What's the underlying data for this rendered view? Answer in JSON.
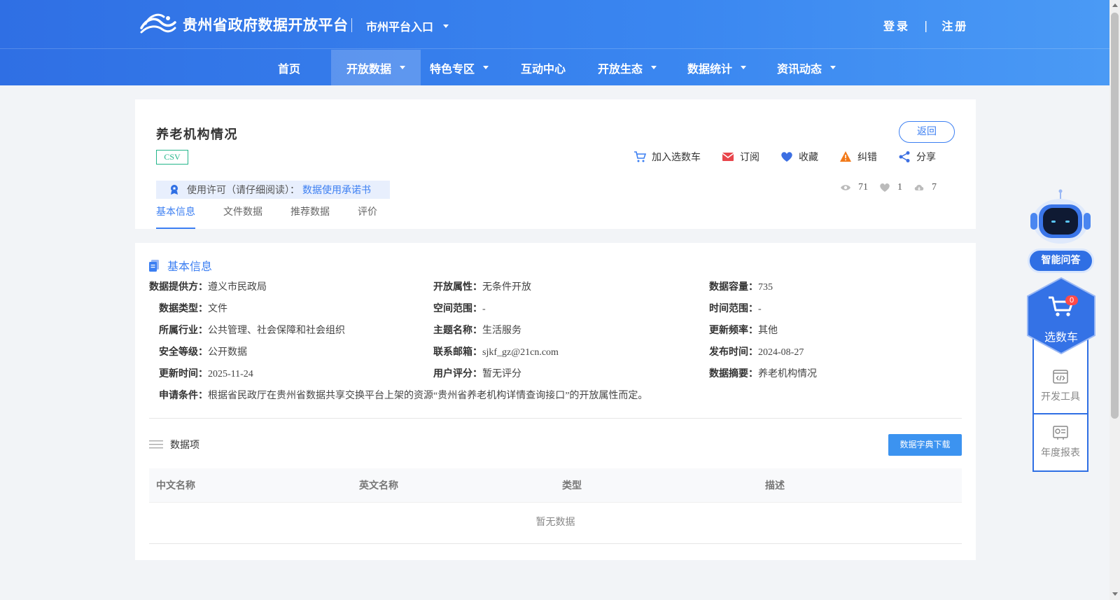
{
  "header": {
    "site_title": "贵州省政府数据开放平台",
    "city_entry": "市州平台入口",
    "login": "登录",
    "register": "注册",
    "auth_separator": "|",
    "nav": [
      {
        "label": "首页",
        "dropdown": false,
        "active": false
      },
      {
        "label": "开放数据",
        "dropdown": true,
        "active": true
      },
      {
        "label": "特色专区",
        "dropdown": true,
        "active": false
      },
      {
        "label": "互动中心",
        "dropdown": false,
        "active": false
      },
      {
        "label": "开放生态",
        "dropdown": true,
        "active": false
      },
      {
        "label": "数据统计",
        "dropdown": true,
        "active": false
      },
      {
        "label": "资讯动态",
        "dropdown": true,
        "active": false
      }
    ]
  },
  "dataset": {
    "title": "养老机构情况",
    "format_tag": "CSV",
    "back_label": "返回",
    "actions": [
      {
        "label": "加入选数车",
        "icon": "cart-icon"
      },
      {
        "label": "订阅",
        "icon": "mail-icon"
      },
      {
        "label": "收藏",
        "icon": "heart-icon"
      },
      {
        "label": "纠错",
        "icon": "warning-icon"
      },
      {
        "label": "分享",
        "icon": "share-icon"
      }
    ],
    "license_text": "使用许可（请仔细阅读）：",
    "license_link": "数据使用承诺书",
    "stats": {
      "views": "71",
      "likes": "1",
      "downloads": "7"
    },
    "tabs": [
      "基本信息",
      "文件数据",
      "推荐数据",
      "评价"
    ],
    "active_tab": 0
  },
  "basic_info": {
    "section_title": "基本信息",
    "rows": [
      [
        {
          "label": "数据提供方：",
          "value": "遵义市民政局"
        },
        {
          "label": "开放属性：",
          "value": "无条件开放"
        },
        {
          "label": "数据容量：",
          "value": "735"
        }
      ],
      [
        {
          "label": "数据类型：",
          "value": "文件"
        },
        {
          "label": "空间范围：",
          "value": "-"
        },
        {
          "label": "时间范围：",
          "value": "-"
        }
      ],
      [
        {
          "label": "所属行业：",
          "value": "公共管理、社会保障和社会组织"
        },
        {
          "label": "主题名称：",
          "value": "生活服务"
        },
        {
          "label": "更新频率：",
          "value": "其他"
        }
      ],
      [
        {
          "label": "安全等级：",
          "value": "公开数据"
        },
        {
          "label": "联系邮箱：",
          "value": "sjkf_gz@21cn.com"
        },
        {
          "label": "发布时间：",
          "value": "2024-08-27"
        }
      ],
      [
        {
          "label": "更新时间：",
          "value": "2025-11-24"
        },
        {
          "label": "用户评分：",
          "value": "暂无评分"
        },
        {
          "label": "数据摘要：",
          "value": "养老机构情况"
        }
      ]
    ],
    "apply_label": "申请条件：",
    "apply_value": "根据省民政厅在贵州省数据共享交换平台上架的资源“贵州省养老机构详情查询接口”的开放属性而定。"
  },
  "data_items": {
    "title": "数据项",
    "download_label": "数据字典下载",
    "columns": [
      "中文名称",
      "英文名称",
      "类型",
      "描述"
    ],
    "empty_text": "暂无数据"
  },
  "sidebar": {
    "qa_label": "智能问答",
    "cart_label": "选数车",
    "cart_count": "0",
    "tools": [
      {
        "label": "开发工具",
        "icon": "code-icon"
      },
      {
        "label": "年度报表",
        "icon": "report-icon"
      }
    ]
  },
  "colors": {
    "primary": "#2f6fe4",
    "link": "#3c7ff2",
    "csv_tag": "#23b58a",
    "download_btn": "#3c93f0"
  }
}
